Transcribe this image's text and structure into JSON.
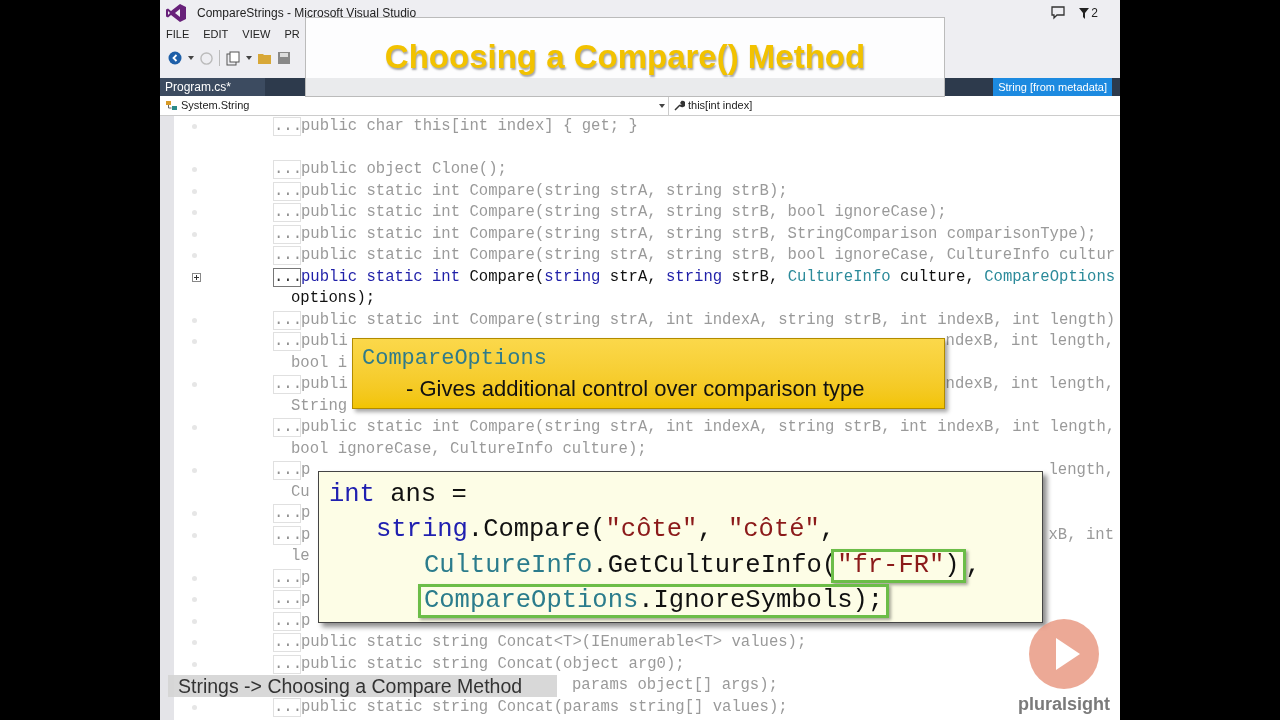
{
  "window": {
    "title": "CompareStrings - Microsoft Visual Studio",
    "notification_count": "2"
  },
  "menu": [
    "FILE",
    "EDIT",
    "VIEW",
    "PR"
  ],
  "document_tab": "Program.cs*",
  "metadata_tab": "String [from metadata]",
  "navigation": {
    "type_dropdown": "System.String",
    "member_dropdown": "this[int index]"
  },
  "code_lines": [
    {
      "kind": "member",
      "marker": "...",
      "dimmed": true,
      "segments": [
        {
          "kind": "plain",
          "text": "public char this[int index] { get; }"
        }
      ]
    },
    {
      "kind": "blank"
    },
    {
      "kind": "member",
      "marker": "...",
      "dimmed": true,
      "segments": [
        {
          "kind": "plain",
          "text": "public object Clone();"
        }
      ]
    },
    {
      "kind": "member",
      "marker": "...",
      "dimmed": true,
      "segments": [
        {
          "kind": "plain",
          "text": "public static int Compare(string strA, string strB);"
        }
      ]
    },
    {
      "kind": "member",
      "marker": "...",
      "dimmed": true,
      "segments": [
        {
          "kind": "plain",
          "text": "public static int Compare(string strA, string strB, bool ignoreCase);"
        }
      ]
    },
    {
      "kind": "member",
      "marker": "...",
      "dimmed": true,
      "segments": [
        {
          "kind": "plain",
          "text": "public static int Compare(string strA, string strB, StringComparison comparisonType);"
        }
      ]
    },
    {
      "kind": "member",
      "marker": "...",
      "dimmed": true,
      "segments": [
        {
          "kind": "plain",
          "text": "public static int Compare(string strA, string strB, bool ignoreCase, CultureInfo cultur"
        }
      ]
    },
    {
      "kind": "member",
      "marker": "...",
      "dimmed": false,
      "segments": [
        {
          "kind": "keyword",
          "text": "public static int"
        },
        {
          "kind": "plain",
          "text": " Compare("
        },
        {
          "kind": "keyword",
          "text": "string"
        },
        {
          "kind": "plain",
          "text": " strA, "
        },
        {
          "kind": "keyword",
          "text": "string"
        },
        {
          "kind": "plain",
          "text": " strB, "
        },
        {
          "kind": "type",
          "text": "CultureInfo"
        },
        {
          "kind": "plain",
          "text": " culture, "
        },
        {
          "kind": "type",
          "text": "CompareOptions"
        }
      ]
    },
    {
      "kind": "continuation",
      "dimmed": false,
      "segments": [
        {
          "kind": "plain",
          "text": "options);"
        }
      ]
    },
    {
      "kind": "member",
      "marker": "...",
      "dimmed": true,
      "segments": [
        {
          "kind": "plain",
          "text": "public static int Compare(string strA, int indexA, string strB, int indexB, int length)"
        }
      ]
    },
    {
      "kind": "member",
      "marker": "...",
      "dimmed": true,
      "segments": [
        {
          "kind": "plain",
          "text": "publi"
        }
      ],
      "trailing": "ndexB, int length,"
    },
    {
      "kind": "continuation",
      "dimmed": true,
      "segments": [
        {
          "kind": "plain",
          "text": "bool i"
        }
      ]
    },
    {
      "kind": "member",
      "marker": "...",
      "dimmed": true,
      "segments": [
        {
          "kind": "plain",
          "text": "publi"
        }
      ],
      "trailing": "ndexB, int length,"
    },
    {
      "kind": "continuation",
      "dimmed": true,
      "segments": [
        {
          "kind": "plain",
          "text": "String"
        }
      ]
    },
    {
      "kind": "member",
      "marker": "...",
      "dimmed": true,
      "segments": [
        {
          "kind": "plain",
          "text": "public static int Compare(string strA, int indexA, string strB, int indexB, int length,"
        }
      ]
    },
    {
      "kind": "continuation",
      "dimmed": true,
      "segments": [
        {
          "kind": "plain",
          "text": "bool ignoreCase, CultureInfo culture);"
        }
      ]
    },
    {
      "kind": "member",
      "marker": "...",
      "dimmed": true,
      "segments": [
        {
          "kind": "plain",
          "text": "p"
        }
      ],
      "trailing": "length,"
    },
    {
      "kind": "continuation",
      "dimmed": true,
      "segments": [
        {
          "kind": "plain",
          "text": "Cu"
        }
      ]
    },
    {
      "kind": "member",
      "marker": "...",
      "dimmed": true,
      "segments": [
        {
          "kind": "plain",
          "text": "p"
        }
      ]
    },
    {
      "kind": "member",
      "marker": "...",
      "dimmed": true,
      "segments": [
        {
          "kind": "plain",
          "text": "p"
        }
      ],
      "trailing": "xB, int"
    },
    {
      "kind": "continuation",
      "dimmed": true,
      "segments": [
        {
          "kind": "plain",
          "text": "le"
        }
      ]
    },
    {
      "kind": "member",
      "marker": "...",
      "dimmed": true,
      "segments": [
        {
          "kind": "plain",
          "text": "p"
        }
      ]
    },
    {
      "kind": "member",
      "marker": "...",
      "dimmed": true,
      "segments": [
        {
          "kind": "plain",
          "text": "p"
        }
      ]
    },
    {
      "kind": "member",
      "marker": "...",
      "dimmed": true,
      "segments": [
        {
          "kind": "plain",
          "text": "p"
        }
      ]
    },
    {
      "kind": "member",
      "marker": "...",
      "dimmed": true,
      "segments": [
        {
          "kind": "plain",
          "text": "public static string Concat<T>(IEnumerable<T> values);"
        }
      ]
    },
    {
      "kind": "member",
      "marker": "...",
      "dimmed": true,
      "segments": [
        {
          "kind": "plain",
          "text": "public static string Concat(object arg0);"
        }
      ]
    },
    {
      "kind": "covered",
      "dimmed": true,
      "segments": [
        {
          "kind": "plain",
          "text": "params object[] args);"
        }
      ]
    },
    {
      "kind": "member",
      "marker": "...",
      "dimmed": true,
      "segments": [
        {
          "kind": "plain",
          "text": "public static string Concat(params string[] values);"
        }
      ]
    }
  ],
  "slide_title": "Choosing a Compare() Method",
  "callout": {
    "term": "CompareOptions",
    "description": "- Gives additional control over comparison type"
  },
  "code_example": {
    "lines": [
      {
        "kind": "declaration",
        "segments": [
          {
            "kind": "keyword",
            "text": "int",
            "boxed": false
          },
          {
            "kind": "plain",
            "text": " ans =",
            "boxed": false
          }
        ]
      },
      {
        "kind": "call",
        "segments": [
          {
            "kind": "keyword",
            "text": "string",
            "boxed": false
          },
          {
            "kind": "plain",
            "text": ".Compare(",
            "boxed": false
          },
          {
            "kind": "string",
            "text": "\"côte\"",
            "boxed": false
          },
          {
            "kind": "plain",
            "text": ", ",
            "boxed": false
          },
          {
            "kind": "string",
            "text": "\"côté\"",
            "boxed": false
          },
          {
            "kind": "plain",
            "text": ",",
            "boxed": false
          }
        ]
      },
      {
        "kind": "argument",
        "segments": [
          {
            "kind": "type",
            "text": "CultureInfo",
            "boxed": false
          },
          {
            "kind": "plain",
            "text": ".GetCultureInfo(",
            "boxed": false
          },
          {
            "kind": "string",
            "text": "\"fr-FR\"",
            "boxed": true
          },
          {
            "kind": "plain",
            "text": ")",
            "boxed": true
          },
          {
            "kind": "plain",
            "text": ",",
            "boxed": false
          }
        ]
      },
      {
        "kind": "argument",
        "segments": [
          {
            "kind": "type",
            "text": "CompareOptions",
            "boxed": true
          },
          {
            "kind": "plain",
            "text": ".IgnoreSymbols);",
            "boxed": true
          }
        ]
      }
    ]
  },
  "caption": "Strings -> Choosing a Compare Method",
  "logo": {
    "text": "pluralsight"
  }
}
